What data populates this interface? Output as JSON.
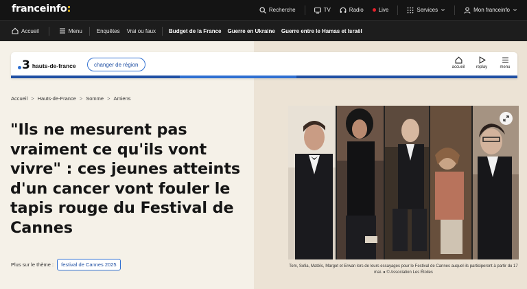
{
  "header": {
    "logo_main": "franceinfo",
    "logo_colon": ":",
    "search_label": "Recherche",
    "tv_label": "TV",
    "radio_label": "Radio",
    "live_label": "Live",
    "services_label": "Services",
    "account_label": "Mon franceinfo"
  },
  "nav": {
    "home_label": "Accueil",
    "menu_label": "Menu",
    "links": [
      "Enquêtes",
      "Vrai ou faux"
    ],
    "topics": [
      "Budget de la France",
      "Guerre en Ukraine",
      "Guerre entre le Hamas et Israël"
    ]
  },
  "regional": {
    "channel_number": "3",
    "region_name": "hauts-de-france",
    "change_label": "changer de région",
    "icons": [
      {
        "label": "accueil",
        "icon": "home-icon"
      },
      {
        "label": "replay",
        "icon": "play-icon"
      },
      {
        "label": "menu",
        "icon": "menu-icon"
      }
    ]
  },
  "breadcrumb": [
    "Accueil",
    "Hauts-de-France",
    "Somme",
    "Amiens"
  ],
  "article": {
    "title": "\"Ils ne mesurent pas vraiment ce qu'ils vont vivre\" : ces jeunes atteints d'un cancer vont fouler le tapis rouge du Festival de Cannes",
    "theme_label": "Plus sur le thème :",
    "theme_tag": "festival de Cannes 2025",
    "caption": "Tom, Sofia, Matéïs, Margot et Erwan lors de leurs essayages pour le Festival de Cannes auquel ils participeront à partir du 17 mai. ● © Association Les Étoiles"
  },
  "colors": {
    "topbar": "#141414",
    "accent_blue": "#2f6fd1",
    "logo_colon": "#ffcd1c",
    "live_dot": "#e4212b",
    "page_bg": "#f5f1e8"
  }
}
